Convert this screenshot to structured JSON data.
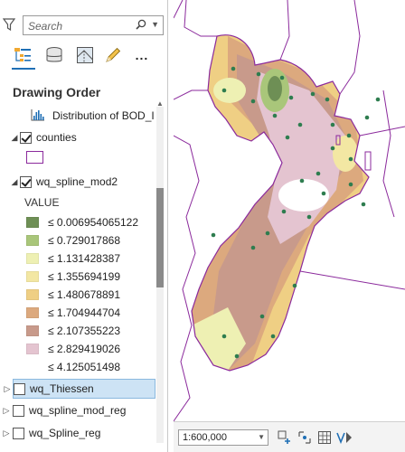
{
  "search": {
    "placeholder": "Search"
  },
  "toolbar": {
    "buttons": [
      {
        "icon": "list-by-drawing-order-icon"
      },
      {
        "icon": "list-by-data-source-icon"
      },
      {
        "icon": "list-by-selection-icon"
      },
      {
        "icon": "list-by-editing-icon"
      },
      {
        "label": "..."
      }
    ]
  },
  "pane": {
    "heading": "Drawing Order"
  },
  "layers": {
    "distribution": {
      "label": "Distribution of BOD_I"
    },
    "counties": {
      "label": "counties",
      "checked": true
    },
    "wq_spline_mod2": {
      "label": "wq_spline_mod2",
      "checked": true,
      "legend_title": "VALUE",
      "classes": [
        {
          "label": "≤ 0.006954065122",
          "color": "#6e8f55"
        },
        {
          "label": "≤ 0.729017868",
          "color": "#a9c67a"
        },
        {
          "label": "≤ 1.131428387",
          "color": "#eef0b3"
        },
        {
          "label": "≤ 1.355694199",
          "color": "#f3e7a3"
        },
        {
          "label": "≤ 1.480678891",
          "color": "#efcf84"
        },
        {
          "label": "≤ 1.704944704",
          "color": "#dca97e"
        },
        {
          "label": "≤ 2.107355223",
          "color": "#c89a8b"
        },
        {
          "label": "≤ 2.829419026",
          "color": "#e4c4d0"
        },
        {
          "label": "≤ 4.125051498",
          "color": "#ffffff"
        }
      ]
    },
    "wq_thiessen": {
      "label": "wq_Thiessen",
      "checked": false,
      "selected": true
    },
    "wq_spline_mod_reg": {
      "label": "wq_spline_mod_reg",
      "checked": false
    },
    "wq_spline_reg": {
      "label": "wq_Spline_reg",
      "checked": false
    }
  },
  "status": {
    "scale": "1:600,000"
  },
  "colors": {
    "county_boundary": "#8b2a9c",
    "sample_points": "#2e7d4f",
    "selection": "#cde3f5"
  }
}
